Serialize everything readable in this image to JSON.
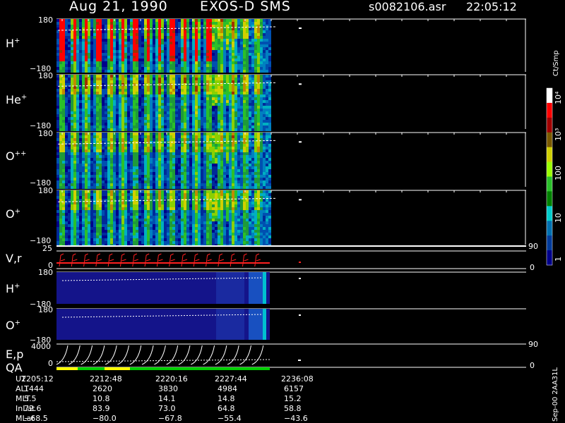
{
  "header": {
    "date": "Aug 21, 1990",
    "instrument": "EXOS-D SMS",
    "file": "s0082106.asr",
    "time": "22:05:12"
  },
  "panels": [
    {
      "label": "H",
      "charge": "+",
      "ytop": "180",
      "ybot": "−180"
    },
    {
      "label": "He",
      "charge": "+",
      "ytop": "180",
      "ybot": "−180"
    },
    {
      "label": "O",
      "charge": "++",
      "ytop": "180",
      "ybot": "−180"
    },
    {
      "label": "O",
      "charge": "+",
      "ytop": "180",
      "ybot": "−180"
    }
  ],
  "vr_panel": {
    "label": "V,r",
    "ytop": "25",
    "ybot": "0",
    "right_top": "90",
    "right_bot": "0"
  },
  "lower_panels": [
    {
      "label": "H",
      "charge": "+",
      "ytop": "180",
      "ybot": "−180"
    },
    {
      "label": "O",
      "charge": "+",
      "ytop": "180",
      "ybot": "−180"
    }
  ],
  "ep_panel": {
    "label": "E,p",
    "ytop": "4000",
    "ybot": "0",
    "right_top": "90",
    "right_bot": "0"
  },
  "qa_label": "QA",
  "colorbar": {
    "unit": "Ct/Smp",
    "labels": [
      "10⁴",
      "10³",
      "100",
      "10",
      "1"
    ],
    "colors": [
      "#ffffff",
      "#ff0000",
      "#a00000",
      "#7a5a00",
      "#cfcf00",
      "#9aff00",
      "#2ac02a",
      "#008000",
      "#00cccc",
      "#0070b0",
      "#003a9a",
      "#00008a"
    ]
  },
  "footer": {
    "rows": [
      {
        "name": "UT",
        "values": [
          "2205:12",
          "2212:48",
          "2220:16",
          "2227:44",
          "2236:08"
        ]
      },
      {
        "name": "ALT",
        "values": [
          "1444",
          "2620",
          "3830",
          "4984",
          "6157"
        ]
      },
      {
        "name": "MLT",
        "values": [
          "5.5",
          "10.8",
          "14.1",
          "14.8",
          "15.2"
        ]
      },
      {
        "name": "InLat",
        "values": [
          "72.6",
          "83.9",
          "73.0",
          "64.8",
          "58.8"
        ]
      },
      {
        "name": "MLat",
        "values": [
          "−68.5",
          "−80.0",
          "−67.8",
          "−55.4",
          "−43.6"
        ]
      }
    ],
    "code": "Sep-00 2AA31L"
  },
  "chart_data": {
    "type": "heatmap",
    "x": [
      "2205:12",
      "2212:48",
      "2220:16",
      "2227:44",
      "2236:08"
    ],
    "panels": [
      "H+",
      "He+",
      "O++",
      "O+",
      "V,r",
      "H+",
      "O+",
      "E,p"
    ],
    "ylim_pitch": [
      -180,
      180
    ],
    "ylim_vr": [
      0,
      25
    ],
    "ylim_energy": [
      0,
      4000
    ],
    "colorbar_unit": "Ct/Smp",
    "colorbar_ticks": [
      "1",
      "10",
      "100",
      "10³",
      "10⁴"
    ]
  }
}
